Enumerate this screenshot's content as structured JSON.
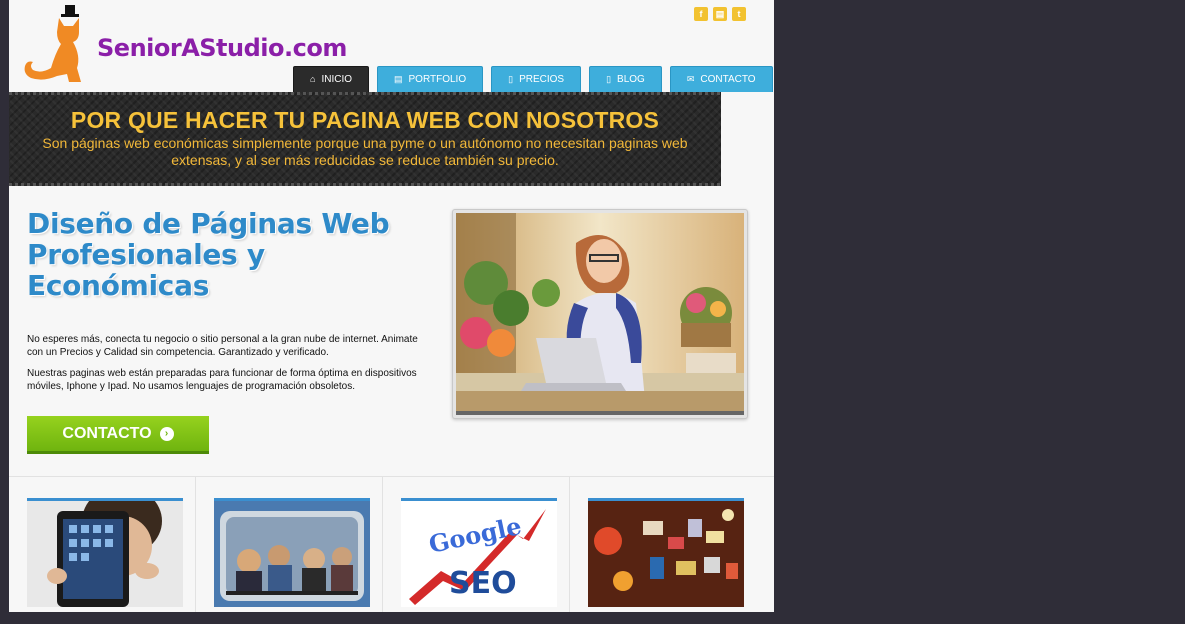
{
  "header": {
    "logo_text": "SeniorAStudio.com",
    "logo_icon": "cat-with-top-hat-icon"
  },
  "social": [
    {
      "name": "facebook-icon",
      "glyph": "f"
    },
    {
      "name": "rss-icon",
      "glyph": "▤"
    },
    {
      "name": "twitter-icon",
      "glyph": "t"
    }
  ],
  "nav": {
    "items": [
      {
        "label": "INICIO",
        "icon": "home-icon",
        "active": true
      },
      {
        "label": "PORTFOLIO",
        "icon": "document-icon",
        "active": false
      },
      {
        "label": "PRECIOS",
        "icon": "document-icon",
        "active": false
      },
      {
        "label": "BLOG",
        "icon": "document-icon",
        "active": false
      },
      {
        "label": "CONTACTO",
        "icon": "mail-icon",
        "active": false
      }
    ]
  },
  "banner": {
    "title": "POR QUE HACER TU PAGINA WEB CON NOSOTROS",
    "subtitle": "Son páginas web económicas simplemente porque una pyme o un autónomo no necesitan paginas web extensas, y al ser más reducidas se reduce también su precio."
  },
  "main": {
    "title": "Diseño de Páginas Web Profesionales y Económicas",
    "paragraph1": "No esperes más, conecta tu negocio o sitio personal a la gran nube de internet. Animate con un Precios y Calidad sin competencia. Garantizado y verificado.",
    "paragraph2": "Nuestras paginas web están preparadas para funcionar de forma óptima en dispositivos móviles, Iphone y Ipad.  No usamos lenguajes de programación obsoletos.",
    "cta_label": "CONTACTO"
  },
  "thumbnails": [
    {
      "name": "tablet-thumbnail"
    },
    {
      "name": "subway-thumbnail"
    },
    {
      "name": "seo-thumbnail",
      "google_text": "Google",
      "seo_text": "SEO"
    },
    {
      "name": "signs-thumbnail"
    }
  ],
  "colors": {
    "brand_purple": "#8b1fa8",
    "nav_blue": "#3eaedc",
    "banner_yellow": "#f6c23a",
    "title_blue": "#2e8ac9",
    "cta_green": "#7fc016"
  }
}
